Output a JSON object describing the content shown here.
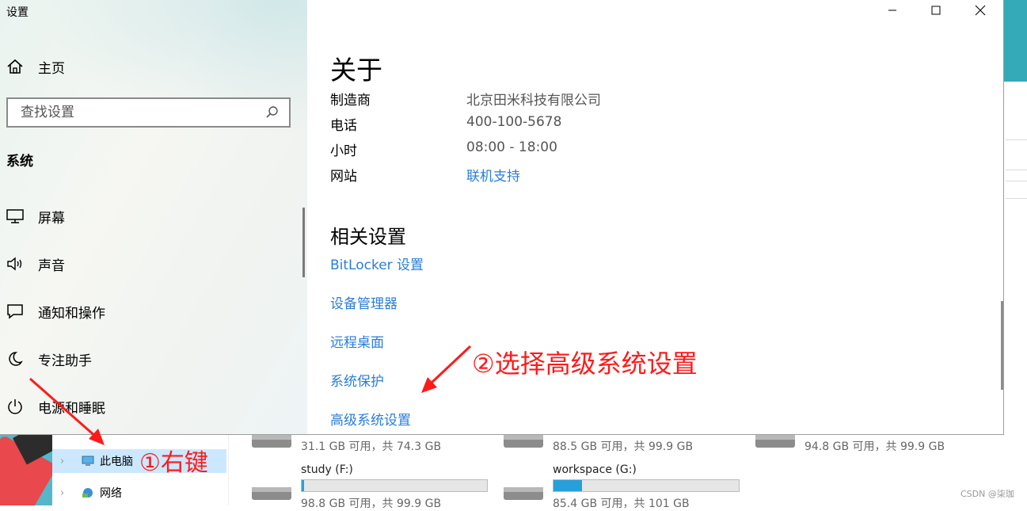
{
  "window": {
    "title": "设置",
    "caption": {
      "minimize": "—",
      "maximize": "☐",
      "close": "✕"
    }
  },
  "sidebar": {
    "home_label": "主页",
    "search_placeholder": "查找设置",
    "section_label": "系统",
    "items": [
      {
        "label": "屏幕",
        "icon": "monitor-icon"
      },
      {
        "label": "声音",
        "icon": "speaker-icon"
      },
      {
        "label": "通知和操作",
        "icon": "notification-icon"
      },
      {
        "label": "专注助手",
        "icon": "moon-icon"
      },
      {
        "label": "电源和睡眠",
        "icon": "power-icon"
      }
    ]
  },
  "about": {
    "title": "关于",
    "rows": [
      {
        "key": "制造商",
        "value": "北京田米科技有限公司",
        "is_link": false
      },
      {
        "key": "电话",
        "value": "400-100-5678",
        "is_link": false
      },
      {
        "key": "小时",
        "value": "08:00 - 18:00",
        "is_link": false
      },
      {
        "key": "网站",
        "value": "联机支持",
        "is_link": true
      }
    ]
  },
  "related": {
    "title": "相关设置",
    "links": [
      "BitLocker 设置",
      "设备管理器",
      "远程桌面",
      "系统保护",
      "高级系统设置"
    ]
  },
  "annotations": {
    "step1": "①右键",
    "step2": "②选择高级系统设置"
  },
  "explorer": {
    "nav": [
      {
        "label": "此电脑",
        "icon": "this-pc-icon",
        "selected": true
      },
      {
        "label": "网络",
        "icon": "network-icon",
        "selected": false
      }
    ],
    "drives_top": [
      {
        "free": "31.1 GB 可用，共 74.3 GB"
      },
      {
        "free": "88.5 GB 可用，共 99.9 GB"
      },
      {
        "free": "94.8 GB 可用，共 99.9 GB"
      }
    ],
    "drives_bottom": [
      {
        "name": "study (F:)",
        "free": "98.8 GB 可用，共 99.9 GB",
        "used_fraction": 0.011
      },
      {
        "name": "workspace (G:)",
        "free": "85.4 GB 可用，共 101 GB",
        "used_fraction": 0.155
      }
    ]
  },
  "watermark": "CSDN @柒珈",
  "colors": {
    "link": "#2a7ed8",
    "annotation": "#ff1a1a",
    "drive_fill": "#26a0da"
  }
}
